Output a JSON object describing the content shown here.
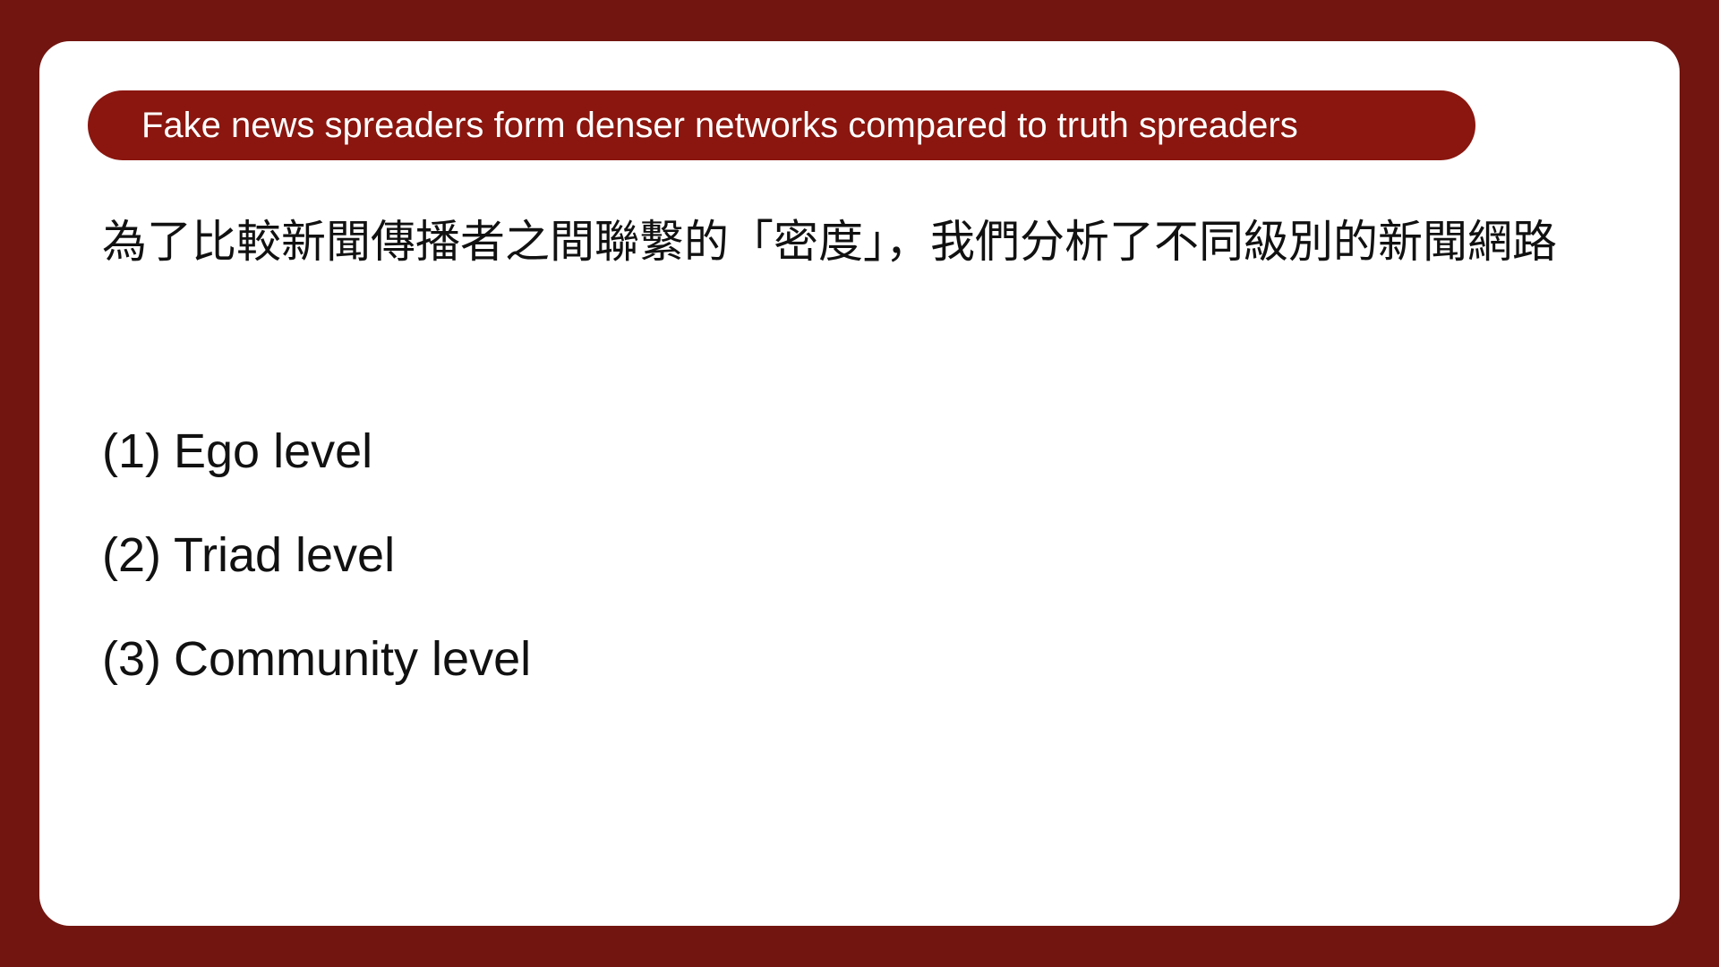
{
  "slide": {
    "title": "Fake news spreaders form denser networks compared to truth spreaders",
    "intro": "為了比較新聞傳播者之間聯繫的「密度」，我們分析了不同級別的新聞網路",
    "levels": [
      {
        "number": "(1)",
        "label": "Ego level"
      },
      {
        "number": "(2)",
        "label": "Triad level"
      },
      {
        "number": "(3)",
        "label": "Community level"
      }
    ]
  },
  "colors": {
    "background": "#721510",
    "title_pill": "#8a160f",
    "card": "#ffffff",
    "text": "#111111"
  }
}
